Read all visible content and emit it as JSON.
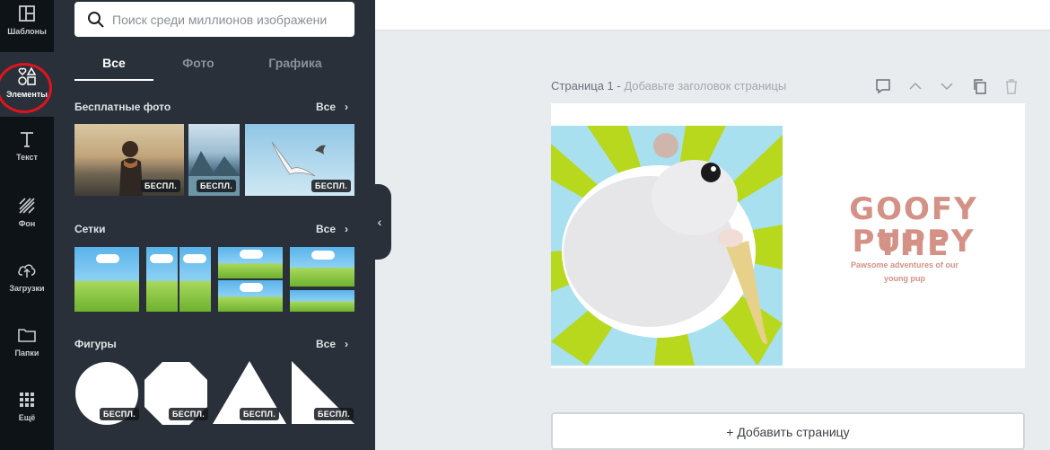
{
  "rail": {
    "items": [
      {
        "label": "Шаблоны",
        "icon": "layout-icon"
      },
      {
        "label": "Элементы",
        "icon": "shapes-icon"
      },
      {
        "label": "Текст",
        "icon": "text-icon"
      },
      {
        "label": "Фон",
        "icon": "background-pattern-icon"
      },
      {
        "label": "Загрузки",
        "icon": "upload-icon"
      },
      {
        "label": "Папки",
        "icon": "folder-icon"
      },
      {
        "label": "Ещё",
        "icon": "more-grid-icon"
      }
    ]
  },
  "panel": {
    "search": {
      "placeholder": "Поиск среди миллионов изображени"
    },
    "tabs": [
      {
        "label": "Все"
      },
      {
        "label": "Фото"
      },
      {
        "label": "Графика"
      }
    ],
    "sections": {
      "photos": {
        "title": "Бесплатные фото",
        "all": "Все",
        "chevron": "›",
        "badge": "БЕСПЛ."
      },
      "grids": {
        "title": "Сетки",
        "all": "Все",
        "chevron": "›"
      },
      "shapes": {
        "title": "Фигуры",
        "all": "Все",
        "chevron": "›",
        "badge": "БЕСПЛ."
      }
    },
    "collapse_icon": "‹"
  },
  "editor": {
    "page_label": "Страница 1 - ",
    "page_title_placeholder": "Добавьте заголовок страницы",
    "design": {
      "title_line1": "GOOFY THE",
      "title_line2": "PUPPY",
      "tagline": "Pawsome adventures of our young pup"
    },
    "add_page": "+ Добавить страницу"
  },
  "colors": {
    "rail_bg": "#0e1318",
    "panel_bg": "#293039",
    "accent_red": "#e0141e",
    "design_text": "#d49186"
  }
}
